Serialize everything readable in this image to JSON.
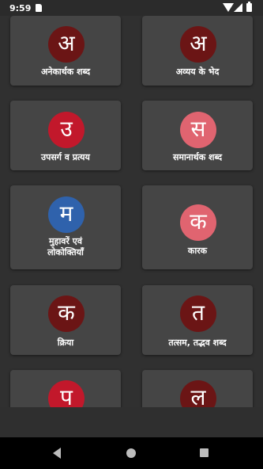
{
  "status_bar": {
    "time": "9:59",
    "icons": [
      "sd-card-icon",
      "wifi-icon",
      "signal-icon",
      "battery-icon"
    ]
  },
  "colors": {
    "background": "#303030",
    "card": "#454545",
    "circle_dark_red": "#6b1515",
    "circle_red": "#c2182b",
    "circle_pink": "#e06470",
    "circle_blue": "#2f62ac"
  },
  "cards": [
    {
      "letter": "अ",
      "label": "अनेकार्थक शब्द",
      "color": "#6b1515"
    },
    {
      "letter": "अ",
      "label": "अव्यय के भेद",
      "color": "#6b1515"
    },
    {
      "letter": "उ",
      "label": "उपसर्ग व प्रत्यय",
      "color": "#c2182b"
    },
    {
      "letter": "स",
      "label": "समानार्थक शब्द",
      "color": "#e06470"
    },
    {
      "letter": "म",
      "label": "मुहावरें एवं\nलोकोक्तियाँ",
      "color": "#2f62ac"
    },
    {
      "letter": "क",
      "label": "कारक",
      "color": "#e06470"
    },
    {
      "letter": "क",
      "label": "क्रिया",
      "color": "#6b1515"
    },
    {
      "letter": "त",
      "label": "तत्सम, तद्भव शब्द",
      "color": "#6b1515"
    },
    {
      "letter": "प",
      "label": "",
      "color": "#c2182b"
    },
    {
      "letter": "ल",
      "label": "",
      "color": "#6b1515"
    }
  ],
  "nav_bar": {
    "icons": [
      "back-icon",
      "home-icon",
      "recents-icon"
    ]
  }
}
